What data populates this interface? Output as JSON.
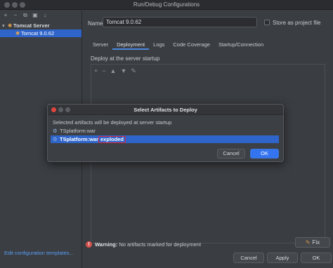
{
  "window": {
    "title": "Run/Debug Configurations"
  },
  "toolbar": {
    "icons": [
      "add-icon",
      "remove-icon",
      "copy-icon",
      "save-icon",
      "sort-icon"
    ]
  },
  "tree": {
    "group_label": "Tomcat Server",
    "item_label": "Tomcat 9.0.62"
  },
  "left_footer": {
    "link": "Edit configuration templates..."
  },
  "config": {
    "name_label": "Name:",
    "name_value": "Tomcat 9.0.62",
    "store_label": "Store as project file"
  },
  "tabs": [
    "Server",
    "Deployment",
    "Logs",
    "Code Coverage",
    "Startup/Connection"
  ],
  "active_tab": "Deployment",
  "deployment": {
    "section_label": "Deploy at the server startup",
    "tools": [
      "+",
      "−",
      "▲",
      "▼",
      "✎"
    ]
  },
  "warning": {
    "prefix": "Warning:",
    "text": "No artifacts marked for deployment",
    "fix_label": "Fix"
  },
  "buttons": {
    "cancel": "Cancel",
    "apply": "Apply",
    "ok": "OK"
  },
  "dialog": {
    "title": "Select Artifacts to Deploy",
    "description": "Selected artifacts will be deployed at server startup",
    "artifacts": [
      {
        "label": "TSplatform:war"
      },
      {
        "label_prefix": "TSplatform:war",
        "label_suffix": "exploded"
      }
    ],
    "cancel": "Cancel",
    "ok": "OK"
  },
  "colors": {
    "accent": "#2f65ca",
    "primary_button": "#3574f0",
    "highlight_border": "#e0253a",
    "link": "#589df6"
  }
}
